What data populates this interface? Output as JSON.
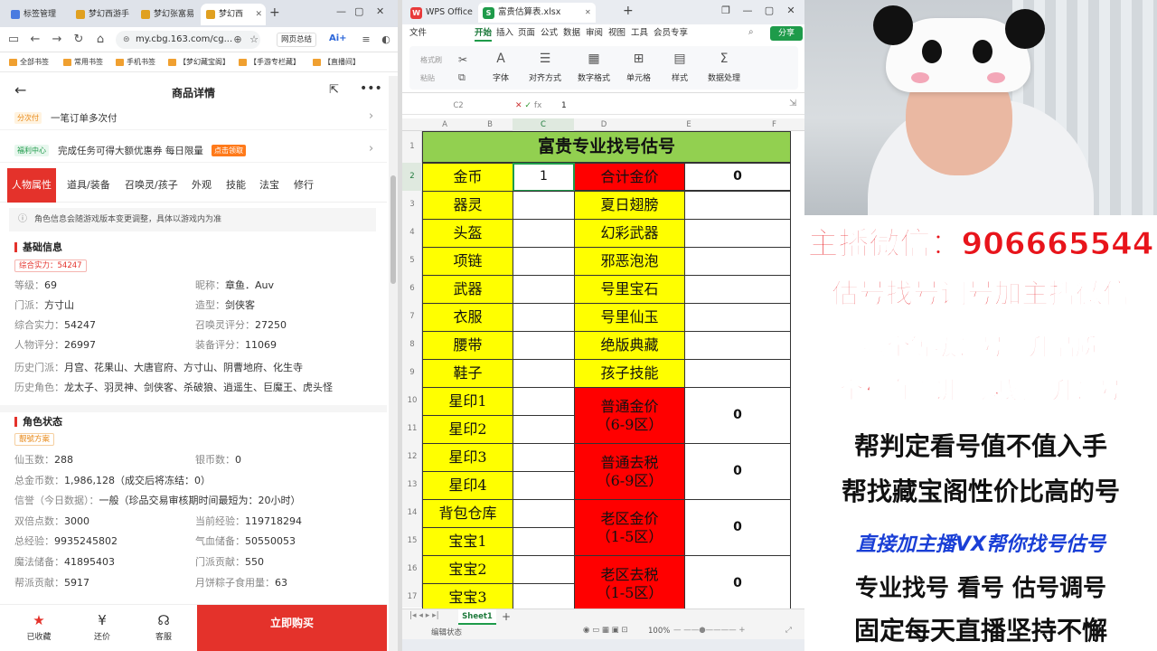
{
  "browser": {
    "tabs": [
      {
        "label": "标签管理"
      },
      {
        "label": "梦幻西游手"
      },
      {
        "label": "梦幻张富易"
      },
      {
        "label": "梦幻西"
      }
    ],
    "new_tab": "+",
    "url": "my.cbg.163.com/cg...",
    "address_right": {
      "summary": "网页总结",
      "ai": "Ai+"
    },
    "bookmarks": [
      "全部书签",
      "常用书签",
      "手机书签",
      "【梦幻藏宝阁】",
      "【手游专栏藏】",
      "【直播间】"
    ]
  },
  "detail": {
    "title": "商品详情",
    "installment": {
      "tag": "分次付",
      "text": "一笔订单多次付"
    },
    "welfare": {
      "tag": "福利中心",
      "text": "完成任务可得大额优惠券 每日限量",
      "badge": "点击领取"
    },
    "tabs": [
      "人物属性",
      "道具/装备",
      "召唤灵/孩子",
      "外观",
      "技能",
      "法宝",
      "修行"
    ],
    "notice": "角色信息会随游戏版本变更调整，具体以游戏内为准",
    "basic": {
      "title": "基础信息",
      "power_tag": "综合实力：54247",
      "items": [
        {
          "k": "等级：",
          "v": "69"
        },
        {
          "k": "昵称：",
          "v": "章鱼．Auv"
        },
        {
          "k": "门派：",
          "v": "方寸山"
        },
        {
          "k": "造型：",
          "v": "剑侠客"
        },
        {
          "k": "综合实力：",
          "v": "54247"
        },
        {
          "k": "召唤灵评分：",
          "v": "27250"
        },
        {
          "k": "人物评分：",
          "v": "26997"
        },
        {
          "k": "装备评分：",
          "v": "11069"
        }
      ],
      "history_sect": {
        "k": "历史门派：",
        "v": "月宫、花果山、大唐官府、方寸山、阴曹地府、化生寺"
      },
      "history_role": {
        "k": "历史角色：",
        "v": "龙太子、羽灵神、剑侠客、杀破狼、逍遥生、巨魔王、虎头怪"
      }
    },
    "status": {
      "title": "角色状态",
      "tag": "靓號方案",
      "rows": [
        [
          {
            "k": "仙玉数：",
            "v": "288"
          },
          {
            "k": "银币数：",
            "v": "0"
          }
        ],
        [
          {
            "k": "总金币数：",
            "v": "1,986,128（成交后将冻结：0）"
          }
        ],
        [
          {
            "k": "信誉（今日数据）：",
            "v": "一般（珍品交易审核期时间最短为：20小时）"
          }
        ],
        [
          {
            "k": "双倍点数：",
            "v": "3000"
          },
          {
            "k": "当前经验：",
            "v": "119718294"
          }
        ],
        [
          {
            "k": "总经验：",
            "v": "9935245802"
          },
          {
            "k": "气血储备：",
            "v": "50550053"
          }
        ],
        [
          {
            "k": "魔法储备：",
            "v": "41895403"
          },
          {
            "k": "门派贡献：",
            "v": "550"
          }
        ],
        [
          {
            "k": "帮派贡献：",
            "v": "5917"
          },
          {
            "k": "月饼粽子食用量：",
            "v": "63"
          }
        ]
      ]
    },
    "bottom": {
      "favorite": {
        "icon": "★",
        "label": "已收藏"
      },
      "bargain": {
        "icon": "¥",
        "label": "还价"
      },
      "service": {
        "icon": "☊",
        "label": "客服"
      },
      "buy": "立即购买"
    }
  },
  "wps": {
    "tabs": [
      {
        "label": "WPS Office"
      },
      {
        "label": "富贵估算表.xlsx"
      }
    ],
    "new_tab": "+",
    "menu": [
      "文件",
      "开始",
      "插入",
      "页面",
      "公式",
      "数据",
      "审阅",
      "视图",
      "工具",
      "会员专享"
    ],
    "share": "分享",
    "ribbon": {
      "small": [
        "格式刷",
        "粘贴"
      ],
      "groups": [
        "字体",
        "对齐方式",
        "数字格式",
        "单元格",
        "样式",
        "数据处理"
      ]
    },
    "cell_ref": "C2",
    "fx": "fx",
    "formula_value": "1",
    "columns": [
      "A",
      "B",
      "C",
      "D",
      "E",
      "F"
    ],
    "rows": [
      "1",
      "2",
      "3",
      "4",
      "5",
      "6",
      "7",
      "8",
      "9",
      "10",
      "11",
      "12",
      "13",
      "14",
      "15",
      "16",
      "17"
    ],
    "sheet": {
      "title": "富贵专业找号估号",
      "left_labels": [
        "金币",
        "器灵",
        "头盔",
        "项链",
        "武器",
        "衣服",
        "腰带",
        "鞋子",
        "星印1",
        "星印2",
        "星印3",
        "星印4",
        "背包仓库",
        "宝宝1",
        "宝宝2",
        "宝宝3"
      ],
      "c2_value": "1",
      "total_label": "合计金价",
      "total_value": "0",
      "right_items": [
        "夏日翅膀",
        "幻彩武器",
        "邪恶泡泡",
        "号里宝石",
        "号里仙玉",
        "绝版典藏",
        "孩子技能"
      ],
      "price_blocks": [
        {
          "line1": "普通金价",
          "line2": "（6-9区）",
          "value": "0"
        },
        {
          "line1": "普通去税",
          "line2": "（6-9区）",
          "value": "0"
        },
        {
          "line1": "老区金价",
          "line2": "（1-5区）",
          "value": "0"
        },
        {
          "line1": "老区去税",
          "line2": "（1-5区）",
          "value": "0"
        }
      ]
    },
    "sheet_tab": "Sheet1",
    "status_left": "编辑状态",
    "zoom": "100%"
  },
  "stream": {
    "lines": [
      "主播微信：906665544",
      "估号找号调号加主播微信",
      "接全等级调号提升品质",
      "全程直播讲解规划提升调号",
      "帮判定看号值不值入手",
      "帮找藏宝阁性价比高的号",
      "直接加主播VX帮你找号估号",
      "专业找号  看号  估号调号",
      "固定每天直播坚持不懈"
    ],
    "colors": {
      "red": "#e8141b",
      "blue": "#1a3fd6",
      "black": "#111111"
    }
  }
}
